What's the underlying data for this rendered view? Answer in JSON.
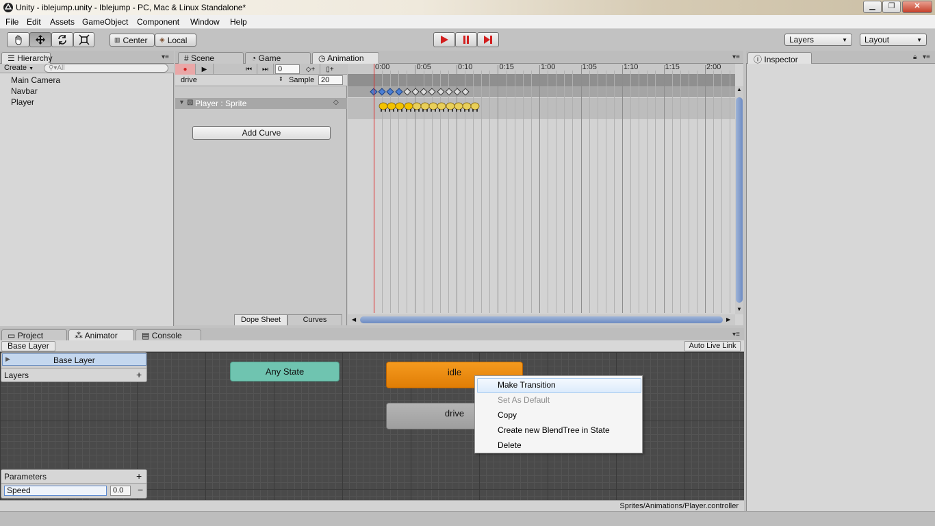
{
  "window": {
    "title": "Unity - iblejump.unity - Iblejump - PC, Mac & Linux Standalone*",
    "minimize_glyph": "▁",
    "maximize_glyph": "❐",
    "close_glyph": "✕"
  },
  "menu": [
    "File",
    "Edit",
    "Assets",
    "GameObject",
    "Component",
    "Window",
    "Help"
  ],
  "toolbar": {
    "transform_tools": [
      "hand-icon",
      "move-icon",
      "rotate-icon",
      "scale-icon"
    ],
    "pivot_label": "Center",
    "space_label": "Local",
    "layers_dropdown": "Layers",
    "layout_dropdown": "Layout",
    "accent": "#d21e1e"
  },
  "hierarchy": {
    "tab": "Hierarchy",
    "create_label": "Create",
    "search_placeholder": "All",
    "items": [
      "Main Camera",
      "Navbar",
      "Player"
    ]
  },
  "center_tabs": {
    "scene": "Scene",
    "game": "Game",
    "animation": "Animation"
  },
  "animation": {
    "frame_value": "0",
    "clip": "drive",
    "sample_label": "Sample",
    "sample_value": "20",
    "property": "Player : Sprite",
    "add_curve": "Add Curve",
    "dope_sheet_tab": "Dope Sheet",
    "curves_tab": "Curves",
    "ruler": [
      "0:00",
      "0:05",
      "0:10",
      "0:15",
      "1:00",
      "1:05",
      "1:10",
      "1:15",
      "2:00"
    ],
    "keyframe_count": 12,
    "selected_keyframes": 4
  },
  "inspector": {
    "tab": "Inspector"
  },
  "bottom_tabs": {
    "project": "Project",
    "animator": "Animator",
    "console": "Console"
  },
  "animator": {
    "breadcrumb": "Base Layer",
    "auto_live_link": "Auto Live Link",
    "layer_name": "Base Layer",
    "layers_title": "Layers",
    "parameters_title": "Parameters",
    "param_name": "Speed",
    "param_value": "0.0",
    "states": {
      "any_state": "Any State",
      "idle": "idle",
      "drive": "drive"
    },
    "colors": {
      "any_state": "#6fc4b0",
      "idle_default": "#f08c0c",
      "normal_state": "#a9a9a9"
    },
    "context_menu": [
      "Make Transition",
      "Set As Default",
      "Copy",
      "Create new BlendTree in State",
      "Delete"
    ],
    "status_path": "Sprites/Animations/Player.controller"
  }
}
